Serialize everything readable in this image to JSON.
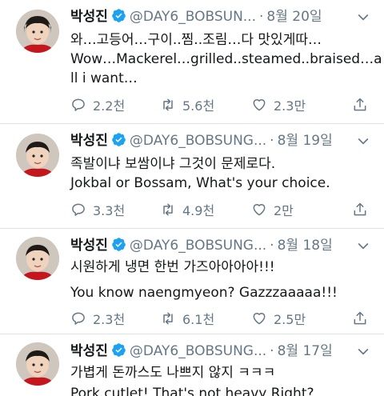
{
  "tweets": [
    {
      "name": "박성진",
      "handle": "@DAY6_BOBSUN...",
      "separator": "·",
      "date": "8월 20일",
      "lines": [
        "와…고등어…구이..찜..조림…다 맛있게따…",
        "Wow…Mackerel…grilled..steamed..braised…a",
        "ll i want…"
      ],
      "reply_count": "2.2천",
      "retweet_count": "5.6천",
      "like_count": "2.3만"
    },
    {
      "name": "박성진",
      "handle": "@DAY6_BOBSUNG...",
      "separator": "·",
      "date": "8월 19일",
      "lines": [
        "족발이냐 보쌈이냐 그것이 문제로다.",
        "Jokbal or Bossam, What's your choice."
      ],
      "reply_count": "3.3천",
      "retweet_count": "4.9천",
      "like_count": "2만"
    },
    {
      "name": "박성진",
      "handle": "@DAY6_BOBSUNG...",
      "separator": "·",
      "date": "8월 18일",
      "lines": [
        "시원하게 냉면 한번 가즈아아아아!!!",
        "You know naengmyeon? Gazzzaaaaa!!!"
      ],
      "reply_count": "2.3천",
      "retweet_count": "6.1천",
      "like_count": "2.5만"
    },
    {
      "name": "박성진",
      "handle": "@DAY6_BOBSUNG...",
      "separator": "·",
      "date": "8월 17일",
      "lines": [
        "가볍게 돈까스도 나쁘지 않지 ㅋㅋㅋ",
        "Pork cutlet! That's not heavy Right?"
      ],
      "reply_count": "",
      "retweet_count": "",
      "like_count": ""
    }
  ],
  "icons": {
    "reply": "reply-icon",
    "retweet": "retweet-icon",
    "like": "heart-icon",
    "share": "share-icon",
    "verified": "verified-badge-icon",
    "chevron": "chevron-down-icon"
  },
  "colors": {
    "text": "#14171a",
    "secondary": "#657786",
    "verified": "#1da1f2",
    "divider": "#dfe3e6"
  }
}
